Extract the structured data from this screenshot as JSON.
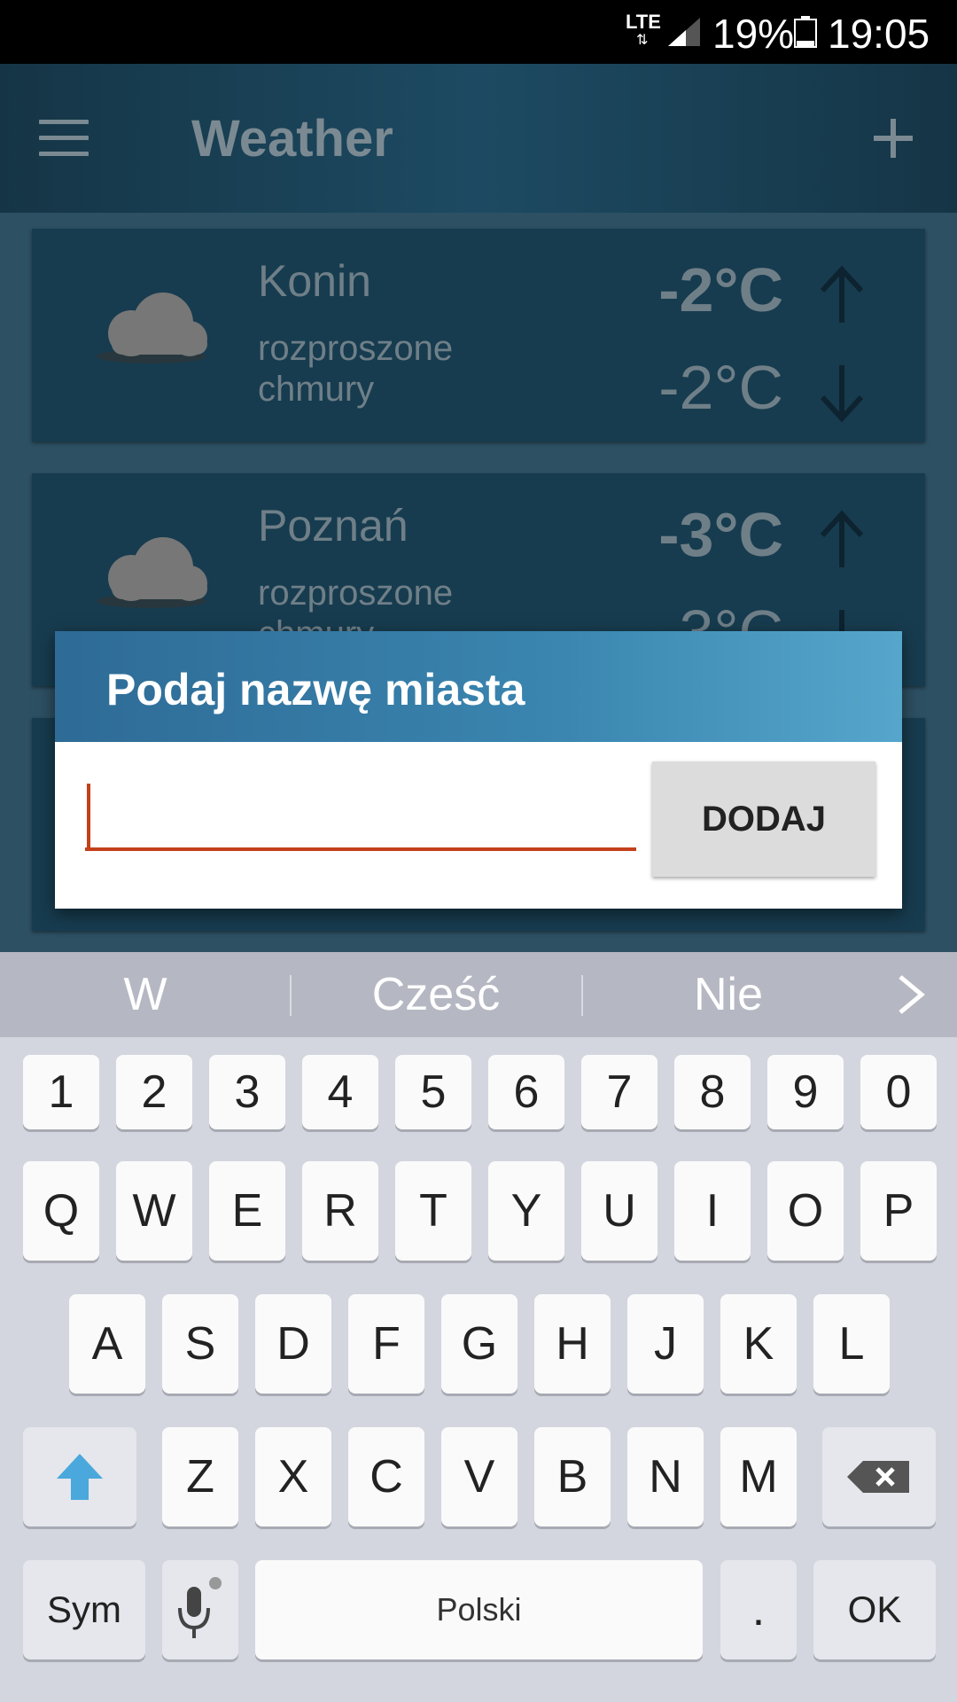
{
  "status_bar": {
    "network": "LTE",
    "network_arrows": "⇅",
    "battery_percent": "19%",
    "time": "19:05"
  },
  "app_bar": {
    "title": "Weather"
  },
  "cities": [
    {
      "name": "Konin",
      "description": "rozproszone chmury",
      "temp_max": "-2°C",
      "temp_min": "-2°C"
    },
    {
      "name": "Poznań",
      "description": "rozproszone chmury",
      "temp_max": "-3°C",
      "temp_min": "-3°C"
    }
  ],
  "dialog": {
    "title": "Podaj nazwę miasta",
    "input_value": "",
    "add_button": "DODAJ"
  },
  "keyboard": {
    "suggestions": [
      "W",
      "Cześć",
      "Nie"
    ],
    "number_row": [
      "1",
      "2",
      "3",
      "4",
      "5",
      "6",
      "7",
      "8",
      "9",
      "0"
    ],
    "row1": [
      "Q",
      "W",
      "E",
      "R",
      "T",
      "Y",
      "U",
      "I",
      "O",
      "P"
    ],
    "row2": [
      "A",
      "S",
      "D",
      "F",
      "G",
      "H",
      "J",
      "K",
      "L"
    ],
    "row3": [
      "Z",
      "X",
      "C",
      "V",
      "B",
      "N",
      "M"
    ],
    "sym": "Sym",
    "space": "Polski",
    "period": ".",
    "ok": "OK"
  },
  "colors": {
    "accent": "#c3401a",
    "dialog_header": "#3a86b0",
    "shift_arrow": "#4aa8dc"
  }
}
